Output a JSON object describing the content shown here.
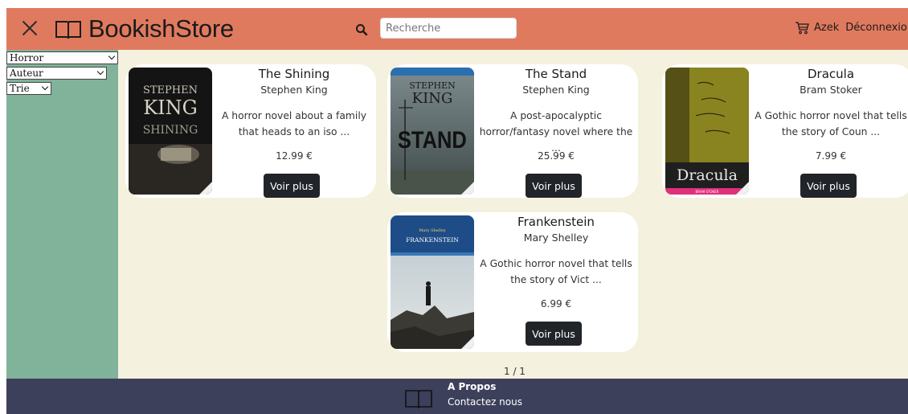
{
  "header": {
    "brand": "BookishStore",
    "search_placeholder": "Recherche",
    "user": "Azek",
    "logout": "Déconnexion"
  },
  "filters": {
    "category": "Horror",
    "author": "Auteur",
    "sort": "Trie"
  },
  "books": [
    {
      "title": "The Shining",
      "author": "Stephen King",
      "description": "A horror novel about a family that heads to an iso ...",
      "price": "12.99 €",
      "cover_text_top": "STEPHEN",
      "cover_text_mid": "KING",
      "cover_text_bottom": "SHINING",
      "button": "Voir plus"
    },
    {
      "title": "The Stand",
      "author": "Stephen King",
      "description": "A post-apocalyptic horror/fantasy novel where the ...",
      "price": "25.99 €",
      "cover_text_top": "STEPHEN",
      "cover_text_mid": "KING",
      "cover_text_bottom": "STAND",
      "button": "Voir plus"
    },
    {
      "title": "Dracula",
      "author": "Bram Stoker",
      "description": "A Gothic horror novel that tells the story of Coun ...",
      "price": "7.99 €",
      "cover_text_main": "Dracula",
      "cover_text_small": "BRAM STOKER",
      "button": "Voir plus"
    },
    {
      "title": "Frankenstein",
      "author": "Mary Shelley",
      "description": "A Gothic horror novel that tells the story of Vict ...",
      "price": "6.99 €",
      "cover_text_small": "Mary Shelley",
      "cover_text_main": "FRANKENSTEIN",
      "button": "Voir plus"
    }
  ],
  "pagination": "1 / 1",
  "footer": {
    "about": "A Propos",
    "contact": "Contactez nous"
  },
  "colors": {
    "header": "#e07a5f",
    "sidebar": "#81b29a",
    "main": "#f4f1de",
    "footer": "#3d405b",
    "button": "#212529"
  }
}
